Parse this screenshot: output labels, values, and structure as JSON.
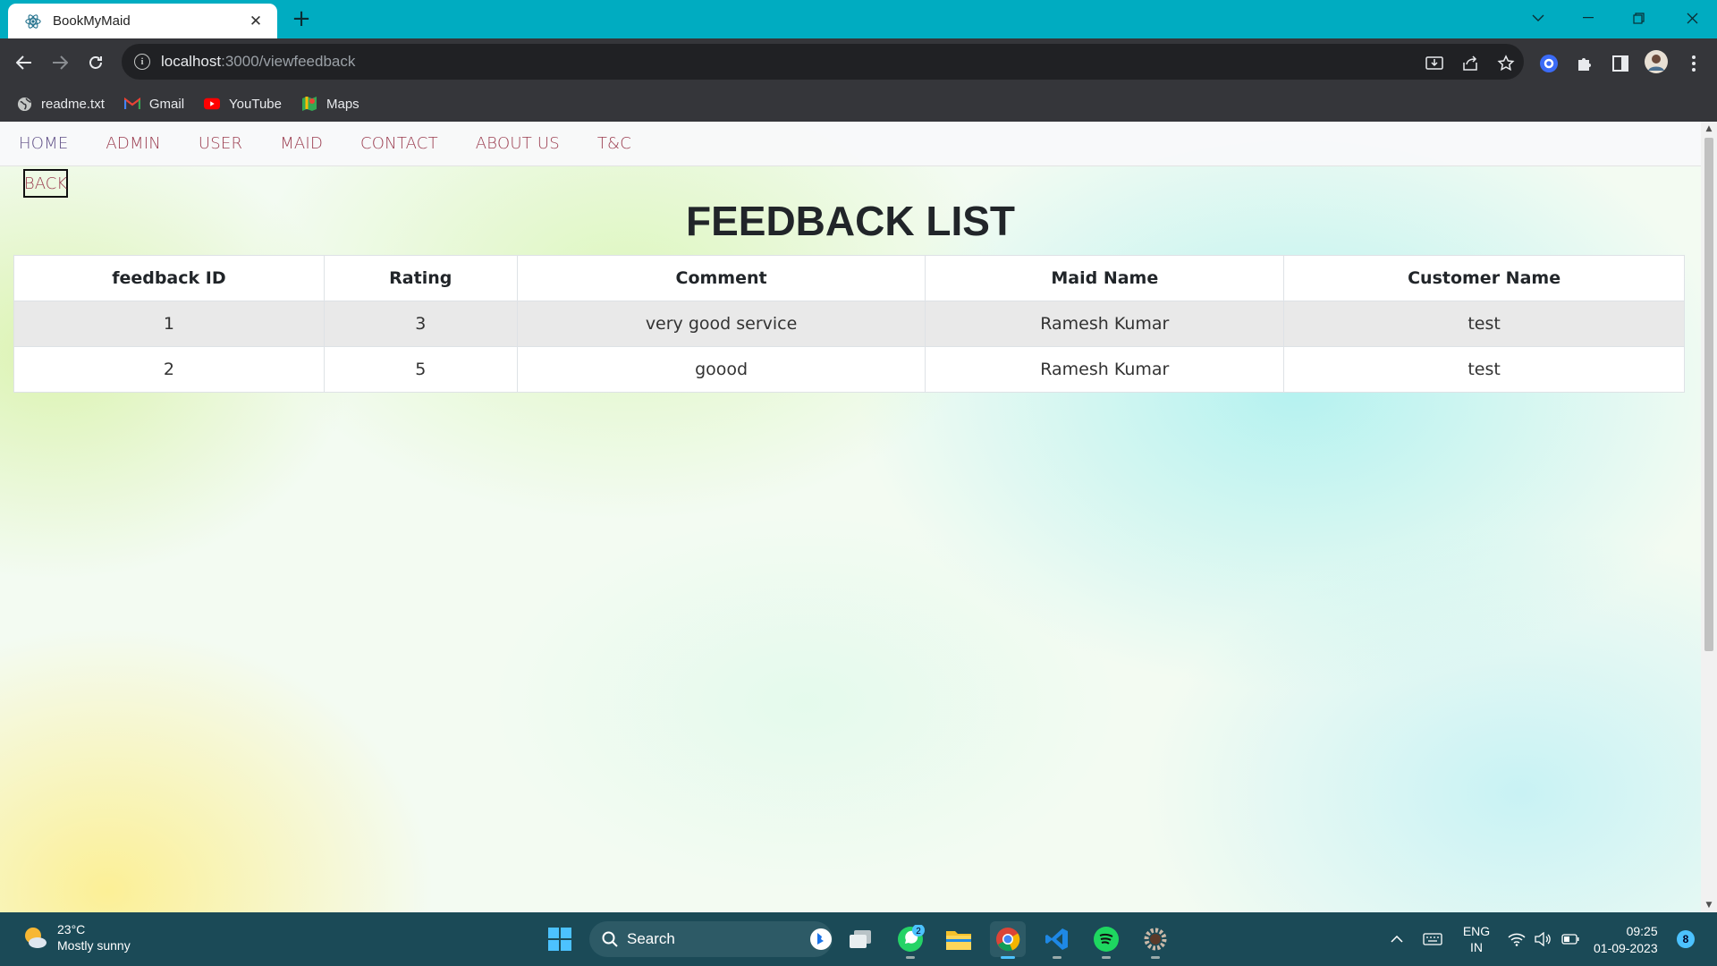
{
  "browser": {
    "tab_title": "BookMyMaid",
    "url_host": "localhost",
    "url_path": ":3000/viewfeedback",
    "bookmarks": [
      {
        "label": "readme.txt",
        "icon": "globe-icon"
      },
      {
        "label": "Gmail",
        "icon": "gmail-icon"
      },
      {
        "label": "YouTube",
        "icon": "youtube-icon"
      },
      {
        "label": "Maps",
        "icon": "maps-icon"
      }
    ],
    "accent_color": "#00acc1"
  },
  "nav": {
    "items": [
      "HOME",
      "ADMIN",
      "USER",
      "MAID",
      "CONTACT",
      "ABOUT US",
      "T&C"
    ]
  },
  "page": {
    "back_label": "BACK",
    "title": "FEEDBACK LIST"
  },
  "table": {
    "headers": [
      "feedback ID",
      "Rating",
      "Comment",
      "Maid Name",
      "Customer Name"
    ],
    "rows": [
      [
        "1",
        "3",
        "very good service",
        "Ramesh Kumar",
        "test"
      ],
      [
        "2",
        "5",
        "goood",
        "Ramesh Kumar",
        "test"
      ]
    ]
  },
  "taskbar": {
    "weather_temp": "23°C",
    "weather_desc": "Mostly sunny",
    "search_label": "Search",
    "whatsapp_badge": "2",
    "lang_primary": "ENG",
    "lang_secondary": "IN",
    "time": "09:25",
    "date": "01-09-2023",
    "notification_count": "8"
  }
}
